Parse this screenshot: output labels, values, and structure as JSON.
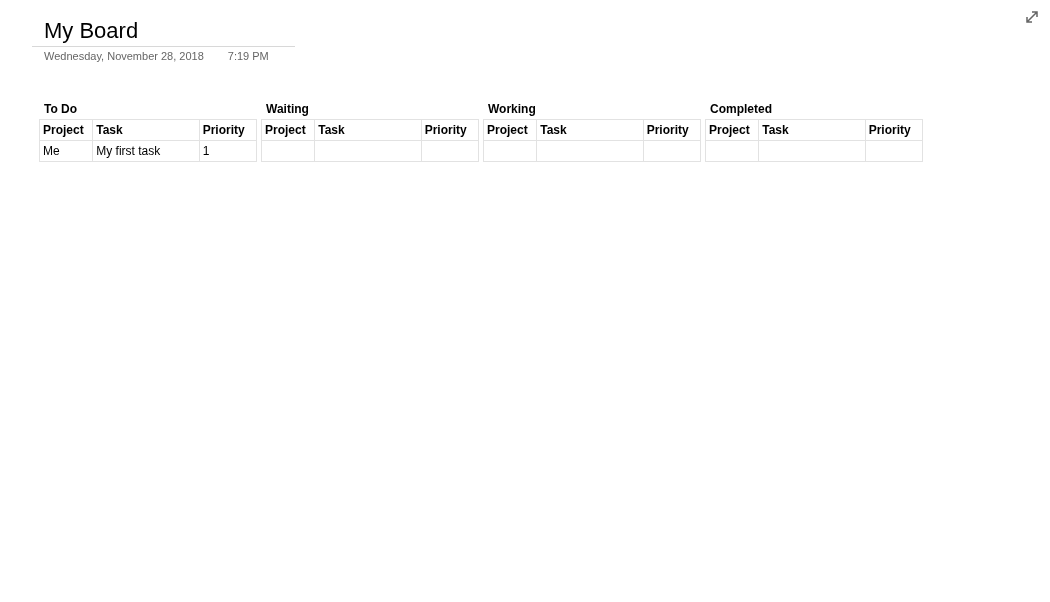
{
  "page": {
    "title": "My Board",
    "date": "Wednesday, November 28, 2018",
    "time": "7:19 PM"
  },
  "boards": [
    {
      "title": "To Do",
      "columns": [
        "Project",
        "Task",
        "Priority"
      ],
      "rows": [
        [
          "Me",
          "My first task",
          "1"
        ]
      ]
    },
    {
      "title": "Waiting",
      "columns": [
        "Project",
        "Task",
        "Priority"
      ]
    },
    {
      "title": "Working",
      "columns": [
        "Project",
        "Task",
        "Priority"
      ]
    },
    {
      "title": "Completed",
      "columns": [
        "Project",
        "Task",
        "Priority"
      ]
    }
  ]
}
